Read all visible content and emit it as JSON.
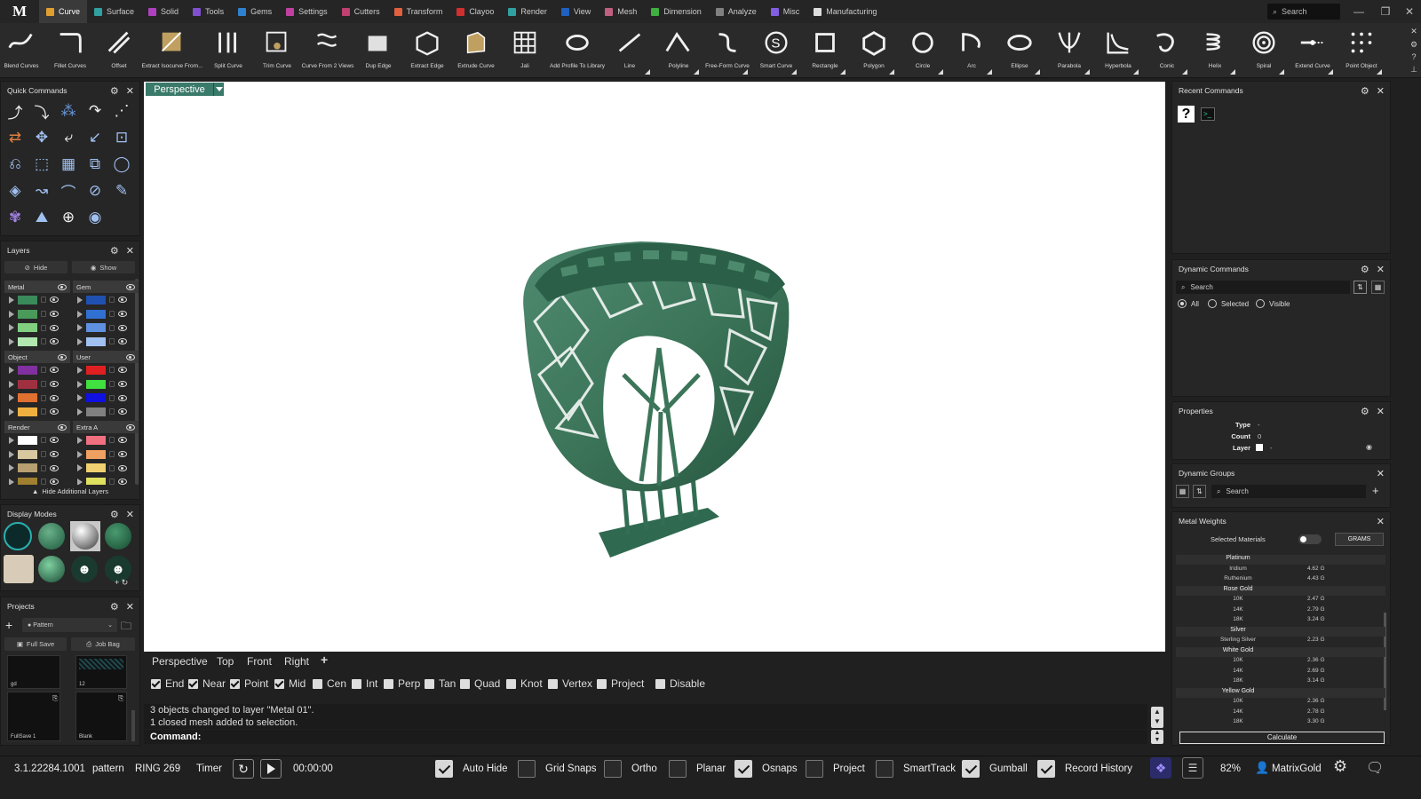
{
  "app": {
    "logo": "M",
    "search_placeholder": "Search"
  },
  "menu_tabs": [
    {
      "label": "Curve",
      "color": "#e0a030"
    },
    {
      "label": "Surface",
      "color": "#30a0a0"
    },
    {
      "label": "Solid",
      "color": "#b040c0"
    },
    {
      "label": "Tools",
      "color": "#8050d0"
    },
    {
      "label": "Gems",
      "color": "#3080d0"
    },
    {
      "label": "Settings",
      "color": "#c040a0"
    },
    {
      "label": "Cutters",
      "color": "#c04070"
    },
    {
      "label": "Transform",
      "color": "#e06040"
    },
    {
      "label": "Clayoo",
      "color": "#d03030"
    },
    {
      "label": "Render",
      "color": "#30a0a0"
    },
    {
      "label": "View",
      "color": "#2060c0"
    },
    {
      "label": "Mesh",
      "color": "#c06080"
    },
    {
      "label": "Dimension",
      "color": "#40b040"
    },
    {
      "label": "Analyze",
      "color": "#808080"
    },
    {
      "label": "Misc",
      "color": "#8060e0"
    },
    {
      "label": "Manufacturing",
      "color": "#dddddd"
    }
  ],
  "toolbar": [
    {
      "label": "Blend Curves",
      "icon": "blend-curves-icon"
    },
    {
      "label": "Fillet Curves",
      "icon": "fillet-curves-icon"
    },
    {
      "label": "Offset",
      "icon": "offset-icon"
    },
    {
      "label": "Extract Isocurve From...",
      "icon": "extract-isocurve-icon"
    },
    {
      "label": "Split Curve",
      "icon": "split-curve-icon"
    },
    {
      "label": "Trim Curve",
      "icon": "trim-curve-icon"
    },
    {
      "label": "Curve From 2 Views",
      "icon": "curve-from-2-views-icon"
    },
    {
      "label": "Dup Edge",
      "icon": "dup-edge-icon"
    },
    {
      "label": "Extract Edge",
      "icon": "extract-edge-icon"
    },
    {
      "label": "Extrude Curve",
      "icon": "extrude-curve-icon"
    },
    {
      "label": "Jali",
      "icon": "jali-icon"
    },
    {
      "label": "Add Profile To Library",
      "icon": "add-profile-icon"
    },
    {
      "label": "Line",
      "icon": "line-icon"
    },
    {
      "label": "Polyline",
      "icon": "polyline-icon"
    },
    {
      "label": "Free-Form Curve",
      "icon": "free-form-curve-icon"
    },
    {
      "label": "Smart Curve",
      "icon": "smart-curve-icon"
    },
    {
      "label": "Rectangle",
      "icon": "rectangle-icon"
    },
    {
      "label": "Polygon",
      "icon": "polygon-icon"
    },
    {
      "label": "Circle",
      "icon": "circle-icon"
    },
    {
      "label": "Arc",
      "icon": "arc-icon"
    },
    {
      "label": "Ellipse",
      "icon": "ellipse-icon"
    },
    {
      "label": "Parabola",
      "icon": "parabola-icon"
    },
    {
      "label": "Hyperbola",
      "icon": "hyperbola-icon"
    },
    {
      "label": "Conic",
      "icon": "conic-icon"
    },
    {
      "label": "Helix",
      "icon": "helix-icon"
    },
    {
      "label": "Spiral",
      "icon": "spiral-icon"
    },
    {
      "label": "Extend Curve",
      "icon": "extend-curve-icon"
    },
    {
      "label": "Point Object",
      "icon": "point-object-icon"
    }
  ],
  "panels": {
    "quick_commands": "Quick Commands",
    "layers": "Layers",
    "display_modes": "Display Modes",
    "projects": "Projects",
    "recent_commands": "Recent Commands",
    "dynamic_commands": "Dynamic Commands",
    "properties": "Properties",
    "dynamic_groups": "Dynamic Groups",
    "metal_weights": "Metal Weights"
  },
  "layers": {
    "hide_label": "Hide",
    "show_label": "Show",
    "groups": [
      {
        "name": "Metal",
        "colors": [
          "#3a8a5a",
          "#4a9a5a",
          "#80d080",
          "#b0e8b0"
        ]
      },
      {
        "name": "Gem",
        "colors": [
          "#2050b0",
          "#3070d0",
          "#6090e0",
          "#a0c0f0"
        ]
      },
      {
        "name": "Object",
        "colors": [
          "#8030a0",
          "#a03040",
          "#e07030",
          "#f0b040"
        ]
      },
      {
        "name": "User",
        "colors": [
          "#e02020",
          "#40e040",
          "#1010e0",
          "#808080"
        ]
      },
      {
        "name": "Render",
        "colors": [
          "#ffffff",
          "#d8c8a0",
          "#b8a070",
          "#a08030"
        ]
      },
      {
        "name": "Extra A",
        "colors": [
          "#f07080",
          "#f0a060",
          "#f0d070",
          "#e0e060"
        ]
      }
    ],
    "hide_additional": "Hide Additional Layers"
  },
  "projects": {
    "dropdown": "Pattern",
    "full_save": "Full Save",
    "job_bag": "Job Bag",
    "thumbs": [
      "gd",
      "12",
      "FullSave 1",
      "Blank"
    ]
  },
  "viewport": {
    "active": "Perspective",
    "tabs": [
      "Perspective",
      "Top",
      "Front",
      "Right",
      "+"
    ]
  },
  "snaps": [
    {
      "label": "End",
      "on": true
    },
    {
      "label": "Near",
      "on": true
    },
    {
      "label": "Point",
      "on": true
    },
    {
      "label": "Mid",
      "on": true
    },
    {
      "label": "Cen",
      "on": false
    },
    {
      "label": "Int",
      "on": false
    },
    {
      "label": "Perp",
      "on": false
    },
    {
      "label": "Tan",
      "on": false
    },
    {
      "label": "Quad",
      "on": false
    },
    {
      "label": "Knot",
      "on": false
    },
    {
      "label": "Vertex",
      "on": false
    },
    {
      "label": "Project",
      "on": false
    },
    {
      "label": "Disable",
      "on": false
    }
  ],
  "command": {
    "history": [
      "3 objects changed to layer \"Metal 01\".",
      "1 closed mesh added to selection."
    ],
    "prompt": "Command:"
  },
  "status": {
    "version": "3.1.22284.1001",
    "pattern": "pattern",
    "ring": "RING 269",
    "timer_label": "Timer",
    "timer_value": "00:00:00",
    "toggles": [
      {
        "label": "Auto Hide",
        "on": true
      },
      {
        "label": "Grid Snaps",
        "on": false
      },
      {
        "label": "Ortho",
        "on": false
      },
      {
        "label": "Planar",
        "on": false
      },
      {
        "label": "Osnaps",
        "on": true
      },
      {
        "label": "Project",
        "on": false
      },
      {
        "label": "SmartTrack",
        "on": false
      },
      {
        "label": "Gumball",
        "on": true
      },
      {
        "label": "Record History",
        "on": true
      }
    ],
    "zoom": "82%",
    "user": "MatrixGold"
  },
  "dynamic_commands": {
    "search": "Search",
    "filters": [
      {
        "label": "All",
        "on": true
      },
      {
        "label": "Selected",
        "on": false
      },
      {
        "label": "Visible",
        "on": false
      }
    ]
  },
  "properties": {
    "type_label": "Type",
    "type_value": "-",
    "count_label": "Count",
    "count_value": "0",
    "layer_label": "Layer",
    "layer_value": "-"
  },
  "dynamic_groups": {
    "search": "Search"
  },
  "metal_weights": {
    "selected_materials": "Selected Materials",
    "unit": "GRAMS",
    "rows": [
      {
        "name": "Platinum",
        "header": true,
        "value": ""
      },
      {
        "name": "Iridium",
        "value": "4.62 G"
      },
      {
        "name": "Ruthenium",
        "value": "4.43 G"
      },
      {
        "name": "Rose Gold",
        "header": true,
        "value": ""
      },
      {
        "name": "10K",
        "value": "2.47 G"
      },
      {
        "name": "14K",
        "value": "2.79 G"
      },
      {
        "name": "18K",
        "value": "3.24 G"
      },
      {
        "name": "Silver",
        "header": true,
        "value": ""
      },
      {
        "name": "Sterling Silver",
        "value": "2.23 G"
      },
      {
        "name": "White Gold",
        "header": true,
        "value": ""
      },
      {
        "name": "10K",
        "value": "2.36 G"
      },
      {
        "name": "14K",
        "value": "2.69 G"
      },
      {
        "name": "18K",
        "value": "3.14 G"
      },
      {
        "name": "Yellow Gold",
        "header": true,
        "value": ""
      },
      {
        "name": "10K",
        "value": "2.36 G"
      },
      {
        "name": "14K",
        "value": "2.78 G"
      },
      {
        "name": "18K",
        "value": "3.30 G"
      }
    ],
    "calculate": "Calculate"
  }
}
